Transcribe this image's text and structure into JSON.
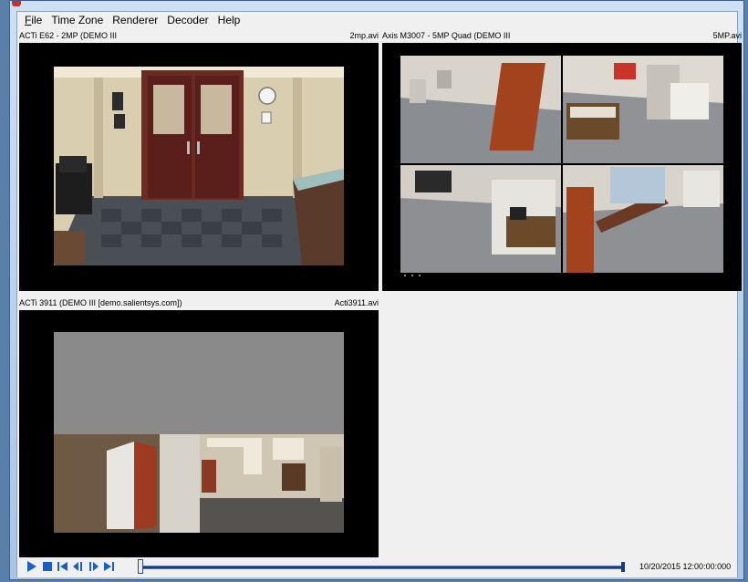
{
  "menu": [
    {
      "key": "F",
      "rest": "ile"
    },
    {
      "key": "",
      "rest": "Time Zone"
    },
    {
      "key": "",
      "rest": "Renderer"
    },
    {
      "key": "",
      "rest": "Decoder"
    },
    {
      "key": "",
      "rest": "Help"
    }
  ],
  "panels": [
    {
      "camera": "ACTi E62 - 2MP (DEMO III",
      "file": "2mp.avi"
    },
    {
      "camera": "Axis M3007 - 5MP Quad (DEMO III",
      "file": "5MP.avi"
    },
    {
      "camera": "ACTi 3911 (DEMO III [demo.salientsys.com])",
      "file": "Acti3911.avi"
    }
  ],
  "playback": {
    "buttons": [
      "play-icon",
      "stop-icon",
      "skip-back-icon",
      "step-back-icon",
      "step-forward-icon",
      "skip-forward-icon"
    ],
    "position": 0,
    "timestamp": "10/20/2015 12:00:00:000",
    "accent": "#1a5fc9"
  }
}
